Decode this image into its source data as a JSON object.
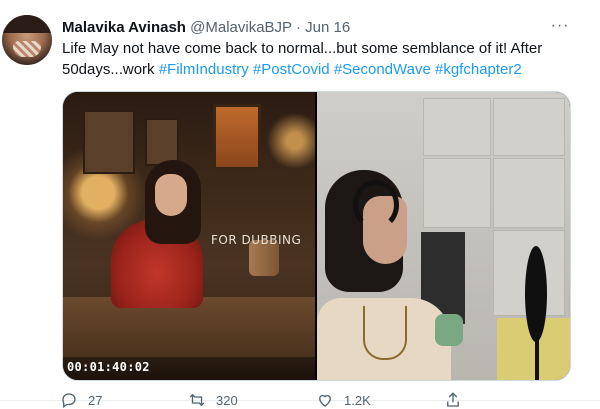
{
  "tweet": {
    "author_name": "Malavika Avinash",
    "handle": "@MalavikaBJP",
    "separator": "·",
    "date": "Jun 16",
    "text_plain": "Life May not have come back to normal...but some semblance of it! After 50days...work ",
    "hashtags": [
      "#FilmIndustry",
      "#PostCovid",
      "#SecondWave",
      "#kgfchapter2"
    ],
    "more_label": "···"
  },
  "media": {
    "left_overlay_text": "FOR DUBBING",
    "timecode": "00:01:40:02"
  },
  "actions": {
    "reply_count": "27",
    "retweet_count": "320",
    "like_count": "1.2K"
  },
  "colors": {
    "accent": "#1d9bf0",
    "secondary_text": "#536471",
    "border": "#cfd9de"
  }
}
